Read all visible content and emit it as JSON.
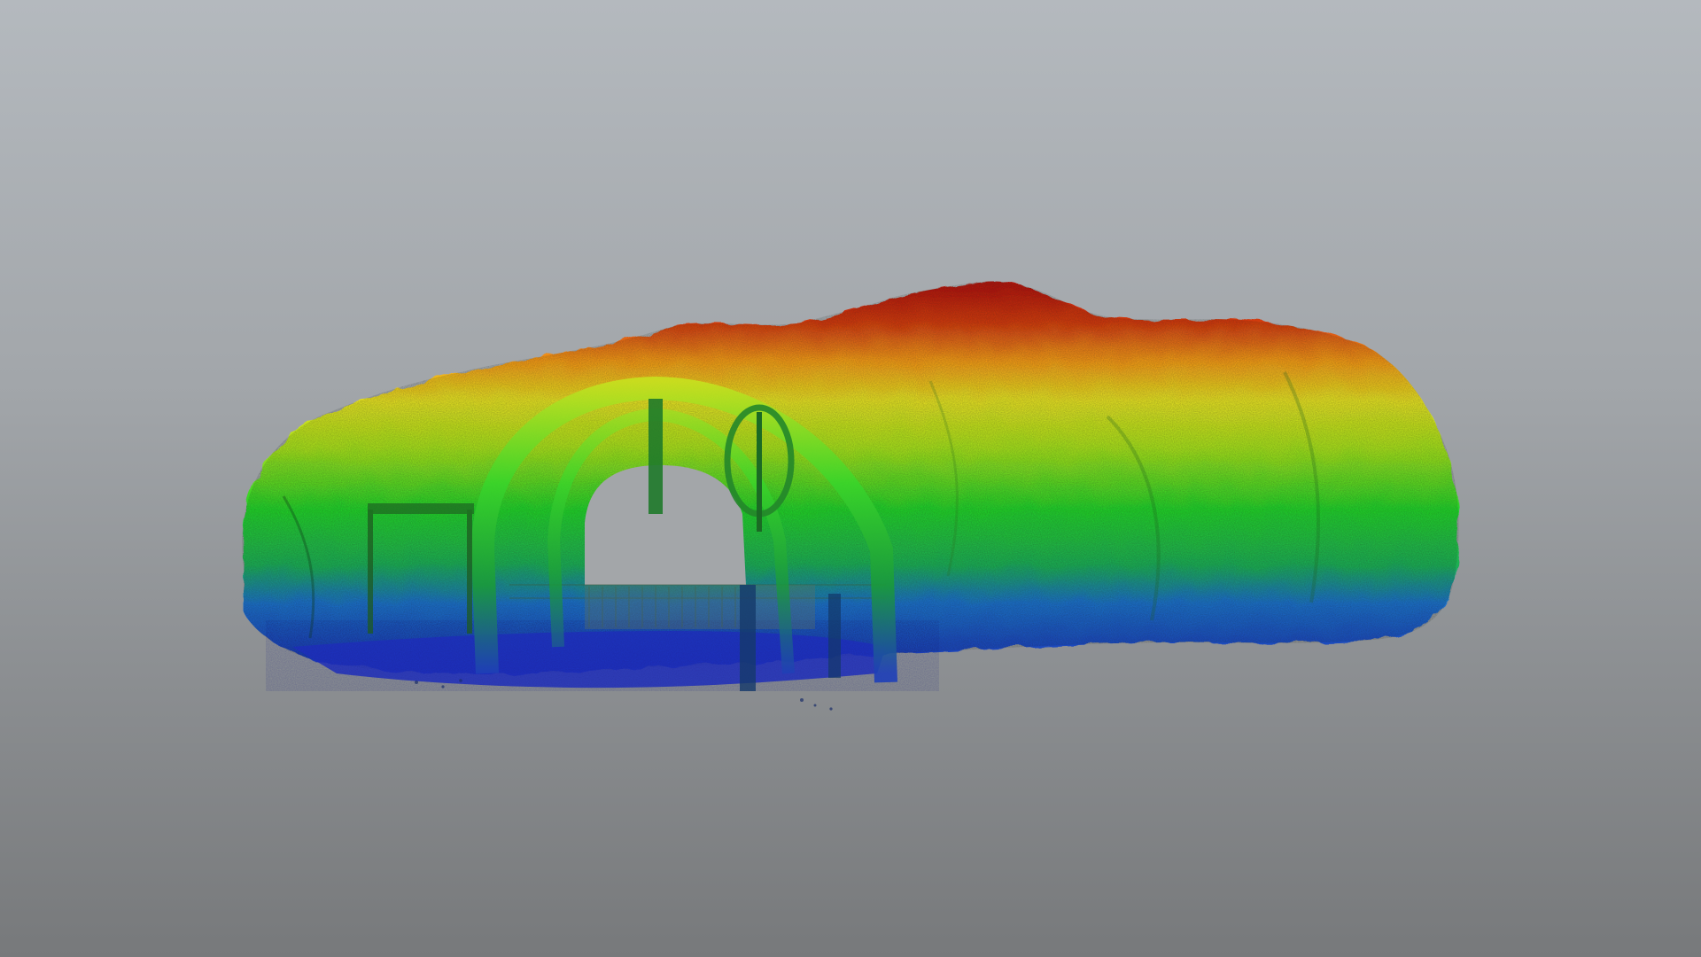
{
  "scene": {
    "background_top": "#b4b9be",
    "background_bottom": "#77797b",
    "colormap": "height-rainbow",
    "colormap_stops": [
      "#1f2fb5",
      "#1f8fd8",
      "#22d12a",
      "#9fe01c",
      "#f1e21a",
      "#f39a18",
      "#d23a10",
      "#b01208"
    ],
    "subject": "tunnel-point-cloud"
  }
}
